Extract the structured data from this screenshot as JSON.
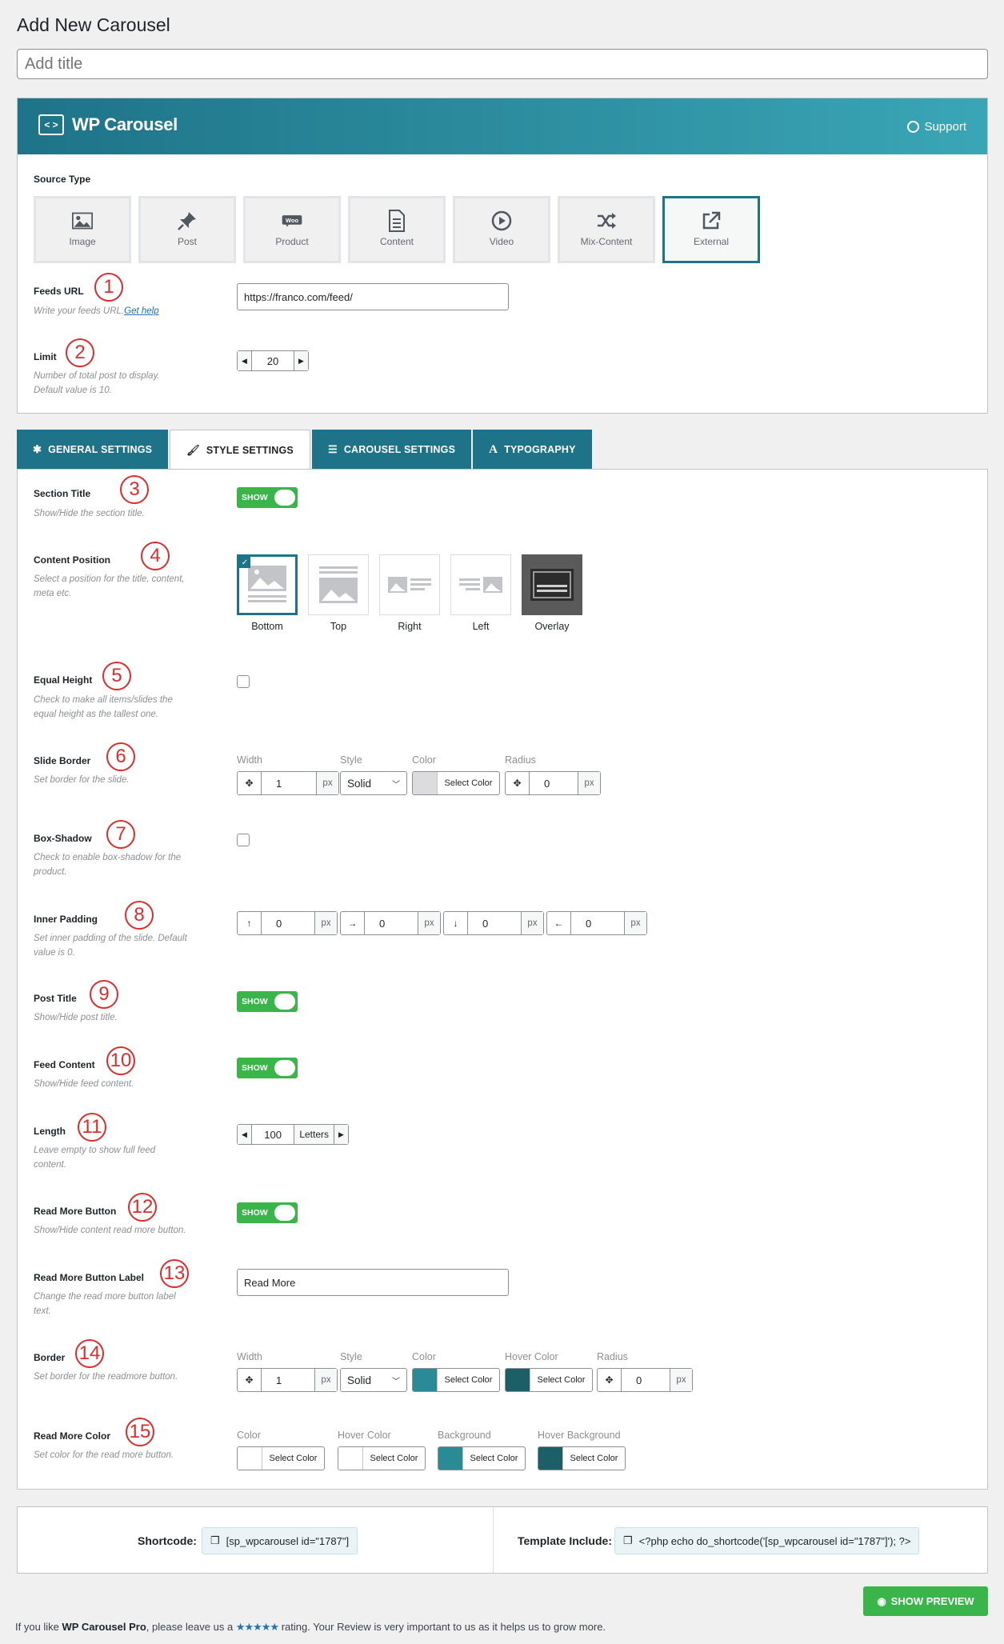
{
  "page": {
    "title": "Add New Carousel",
    "title_placeholder": "Add title"
  },
  "banner": {
    "brand": "WP Carousel",
    "brand_icon": "code-box-icon",
    "support": "Support"
  },
  "source": {
    "label": "Source Type",
    "options": [
      {
        "label": "Image",
        "icon": "image-icon",
        "active": false
      },
      {
        "label": "Post",
        "icon": "pin-icon",
        "active": false
      },
      {
        "label": "Product",
        "icon": "woo-icon",
        "active": false
      },
      {
        "label": "Content",
        "icon": "document-icon",
        "active": false
      },
      {
        "label": "Video",
        "icon": "play-icon",
        "active": false
      },
      {
        "label": "Mix-Content",
        "icon": "shuffle-icon",
        "active": false
      },
      {
        "label": "External",
        "icon": "external-link-icon",
        "active": true
      }
    ],
    "woo_glyph": "Woo"
  },
  "feeds": {
    "label": "Feeds URL",
    "desc": "Write your feeds URL.",
    "help": "Get help",
    "value": "https://franco.com/feed/"
  },
  "limit": {
    "label": "Limit",
    "desc1": "Number of total post to display.",
    "desc2": "Default value is 10.",
    "value": "20"
  },
  "tabs": [
    {
      "label": "GENERAL SETTINGS",
      "icon": "gear-icon",
      "active": false
    },
    {
      "label": "STYLE SETTINGS",
      "icon": "brush-icon",
      "active": true
    },
    {
      "label": "CAROUSEL SETTINGS",
      "icon": "sliders-icon",
      "active": false
    },
    {
      "label": "TYPOGRAPHY",
      "icon": "type-icon",
      "active": false
    }
  ],
  "section_title": {
    "label": "Section Title",
    "desc": "Show/Hide the section title.",
    "toggle": "SHOW"
  },
  "content_position": {
    "label": "Content Position",
    "desc1": "Select a position for the title, content,",
    "desc2": "meta etc.",
    "options": [
      "Bottom",
      "Top",
      "Right",
      "Left",
      "Overlay"
    ]
  },
  "equal_height": {
    "label": "Equal Height",
    "desc1": "Check to make all items/slides the",
    "desc2": "equal height as the tallest one."
  },
  "slide_border": {
    "label": "Slide Border",
    "desc": "Set border for the slide.",
    "width_label": "Width",
    "style_label": "Style",
    "color_label": "Color",
    "radius_label": "Radius",
    "width": "1",
    "style": "Solid",
    "radius": "0",
    "unit": "px",
    "color_btn": "Select Color",
    "swatch": "#dcdcde"
  },
  "box_shadow": {
    "label": "Box-Shadow",
    "desc1": "Check to enable box-shadow for the",
    "desc2": "product."
  },
  "inner_padding": {
    "label": "Inner Padding",
    "desc1": "Set inner padding of the slide. Default",
    "desc2": "value is 0.",
    "values": [
      "0",
      "0",
      "0",
      "0"
    ],
    "unit": "px"
  },
  "post_title": {
    "label": "Post Title",
    "desc": "Show/Hide post title.",
    "toggle": "SHOW"
  },
  "feed_content": {
    "label": "Feed Content",
    "desc": "Show/Hide feed content.",
    "toggle": "SHOW"
  },
  "length": {
    "label": "Length",
    "desc1": "Leave empty to show full feed",
    "desc2": "content.",
    "value": "100",
    "unit": "Letters"
  },
  "read_more": {
    "label": "Read More Button",
    "desc": "Show/Hide content read more button.",
    "toggle": "SHOW"
  },
  "read_more_label": {
    "label": "Read More Button Label",
    "desc1": "Change the read more button label",
    "desc2": "text.",
    "value": "Read More"
  },
  "border": {
    "label": "Border",
    "desc": "Set border for the readmore button.",
    "width_label": "Width",
    "style_label": "Style",
    "color_label": "Color",
    "hover_label": "Hover Color",
    "radius_label": "Radius",
    "width": "1",
    "style": "Solid",
    "radius": "0",
    "unit": "px",
    "color_btn": "Select Color",
    "color": "#2a8a96",
    "hover": "#1d5f66"
  },
  "read_more_color": {
    "label": "Read More Color",
    "desc": "Set color for the read more button.",
    "color_label": "Color",
    "hover_label": "Hover Color",
    "bg_label": "Background",
    "hover_bg_label": "Hover Background",
    "color_btn": "Select Color",
    "color": "#ffffff",
    "hover": "#ffffff",
    "bg": "#2a8a96",
    "hover_bg": "#1d5f66"
  },
  "shortcode": {
    "label": "Shortcode:",
    "value": "[sp_wpcarousel id=\"1787\"]",
    "template_label": "Template Include:",
    "template_value": "<?php echo do_shortcode('[sp_wpcarousel id=\"1787\"]'); ?>"
  },
  "preview_btn": "SHOW PREVIEW",
  "footer": {
    "pre": "If you like ",
    "product": "WP Carousel Pro",
    "mid": ", please leave us a ",
    "stars": "★★★★★",
    "post": " rating. Your Review is very important to us as it helps us to grow more."
  },
  "callouts": [
    "1",
    "2",
    "3",
    "4",
    "5",
    "6",
    "7",
    "8",
    "9",
    "10",
    "11",
    "12",
    "13",
    "14",
    "15"
  ],
  "accent": "#1e7388",
  "toggle_color": "#39b54a"
}
